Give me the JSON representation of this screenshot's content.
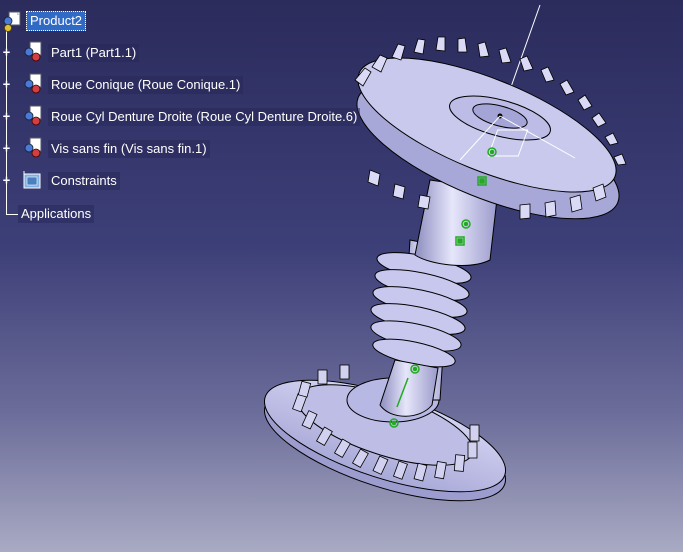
{
  "tree": {
    "root": {
      "label": "Product2",
      "icon": "product-icon",
      "selected": true
    },
    "items": [
      {
        "label": "Part1 (Part1.1)",
        "icon": "part-icon"
      },
      {
        "label": "Roue Conique (Roue Conique.1)",
        "icon": "part-icon"
      },
      {
        "label": "Roue Cyl Denture Droite (Roue Cyl Denture Droite.6)",
        "icon": "part-icon"
      },
      {
        "label": "Vis sans fin (Vis sans fin.1)",
        "icon": "part-icon"
      },
      {
        "label": "Constraints",
        "icon": "constraints-icon"
      }
    ],
    "applications": {
      "label": "Applications"
    }
  },
  "colors": {
    "part_fill": "#c9c9ee",
    "part_edge": "#000000",
    "constraint_green": "#22aa22",
    "axis_white": "#ffffff"
  }
}
